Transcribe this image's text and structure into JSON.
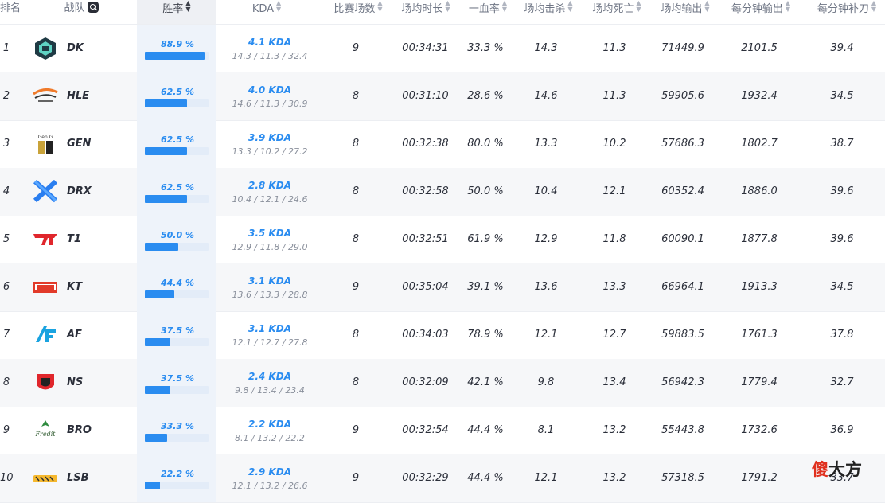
{
  "header": {
    "rank": "排名",
    "team": "战队",
    "winrate": "胜率",
    "kda": "KDA",
    "games": "比赛场数",
    "duration": "场均时长",
    "first_blood": "一血率",
    "kills": "场均击杀",
    "deaths": "场均死亡",
    "damage": "场均输出",
    "dpm": "每分钟输出",
    "cspm": "每分钟补刀"
  },
  "icons": {
    "search": "search-icon",
    "sort": "sort-arrows-icon"
  },
  "colors": {
    "accent": "#2a8cf0",
    "bar_track": "#e3ecf8",
    "row_alt": "#f6f7f9"
  },
  "rows": [
    {
      "rank": "1",
      "team": "DK",
      "winrate": "88.9 %",
      "win_fraction": 0.889,
      "kda": "4.1 KDA",
      "kda_detail": "14.3 / 11.3 / 32.4",
      "games": "9",
      "duration": "00:34:31",
      "first_blood": "33.3 %",
      "kills": "14.3",
      "deaths": "11.3",
      "damage": "71449.9",
      "dpm": "2101.5",
      "cspm": "39.4"
    },
    {
      "rank": "2",
      "team": "HLE",
      "winrate": "62.5 %",
      "win_fraction": 0.625,
      "kda": "4.0 KDA",
      "kda_detail": "14.6 / 11.3 / 30.9",
      "games": "8",
      "duration": "00:31:10",
      "first_blood": "28.6 %",
      "kills": "14.6",
      "deaths": "11.3",
      "damage": "59905.6",
      "dpm": "1932.4",
      "cspm": "34.5"
    },
    {
      "rank": "3",
      "team": "GEN",
      "winrate": "62.5 %",
      "win_fraction": 0.625,
      "kda": "3.9 KDA",
      "kda_detail": "13.3 / 10.2 / 27.2",
      "games": "8",
      "duration": "00:32:38",
      "first_blood": "80.0 %",
      "kills": "13.3",
      "deaths": "10.2",
      "damage": "57686.3",
      "dpm": "1802.7",
      "cspm": "38.7"
    },
    {
      "rank": "4",
      "team": "DRX",
      "winrate": "62.5 %",
      "win_fraction": 0.625,
      "kda": "2.8 KDA",
      "kda_detail": "10.4 / 12.1 / 24.6",
      "games": "8",
      "duration": "00:32:58",
      "first_blood": "50.0 %",
      "kills": "10.4",
      "deaths": "12.1",
      "damage": "60352.4",
      "dpm": "1886.0",
      "cspm": "39.6"
    },
    {
      "rank": "5",
      "team": "T1",
      "winrate": "50.0 %",
      "win_fraction": 0.5,
      "kda": "3.5 KDA",
      "kda_detail": "12.9 / 11.8 / 29.0",
      "games": "8",
      "duration": "00:32:51",
      "first_blood": "61.9 %",
      "kills": "12.9",
      "deaths": "11.8",
      "damage": "60090.1",
      "dpm": "1877.8",
      "cspm": "39.6"
    },
    {
      "rank": "6",
      "team": "KT",
      "winrate": "44.4 %",
      "win_fraction": 0.444,
      "kda": "3.1 KDA",
      "kda_detail": "13.6 / 13.3 / 28.8",
      "games": "9",
      "duration": "00:35:04",
      "first_blood": "39.1 %",
      "kills": "13.6",
      "deaths": "13.3",
      "damage": "66964.1",
      "dpm": "1913.3",
      "cspm": "34.5"
    },
    {
      "rank": "7",
      "team": "AF",
      "winrate": "37.5 %",
      "win_fraction": 0.375,
      "kda": "3.1 KDA",
      "kda_detail": "12.1 / 12.7 / 27.8",
      "games": "8",
      "duration": "00:34:03",
      "first_blood": "78.9 %",
      "kills": "12.1",
      "deaths": "12.7",
      "damage": "59883.5",
      "dpm": "1761.3",
      "cspm": "37.8"
    },
    {
      "rank": "8",
      "team": "NS",
      "winrate": "37.5 %",
      "win_fraction": 0.375,
      "kda": "2.4 KDA",
      "kda_detail": "9.8 / 13.4 / 23.4",
      "games": "8",
      "duration": "00:32:09",
      "first_blood": "42.1 %",
      "kills": "9.8",
      "deaths": "13.4",
      "damage": "56942.3",
      "dpm": "1779.4",
      "cspm": "32.7"
    },
    {
      "rank": "9",
      "team": "BRO",
      "winrate": "33.3 %",
      "win_fraction": 0.333,
      "kda": "2.2 KDA",
      "kda_detail": "8.1 / 13.2 / 22.2",
      "games": "9",
      "duration": "00:32:54",
      "first_blood": "44.4 %",
      "kills": "8.1",
      "deaths": "13.2",
      "damage": "55443.8",
      "dpm": "1732.6",
      "cspm": "36.9"
    },
    {
      "rank": "10",
      "team": "LSB",
      "winrate": "22.2 %",
      "win_fraction": 0.222,
      "kda": "2.9 KDA",
      "kda_detail": "12.1 / 13.2 / 26.6",
      "games": "9",
      "duration": "00:32:29",
      "first_blood": "44.4 %",
      "kills": "12.1",
      "deaths": "13.2",
      "damage": "57318.5",
      "dpm": "1791.2",
      "cspm": "33.7"
    }
  ],
  "watermark": {
    "part1": "傻",
    "part2": "大方"
  }
}
